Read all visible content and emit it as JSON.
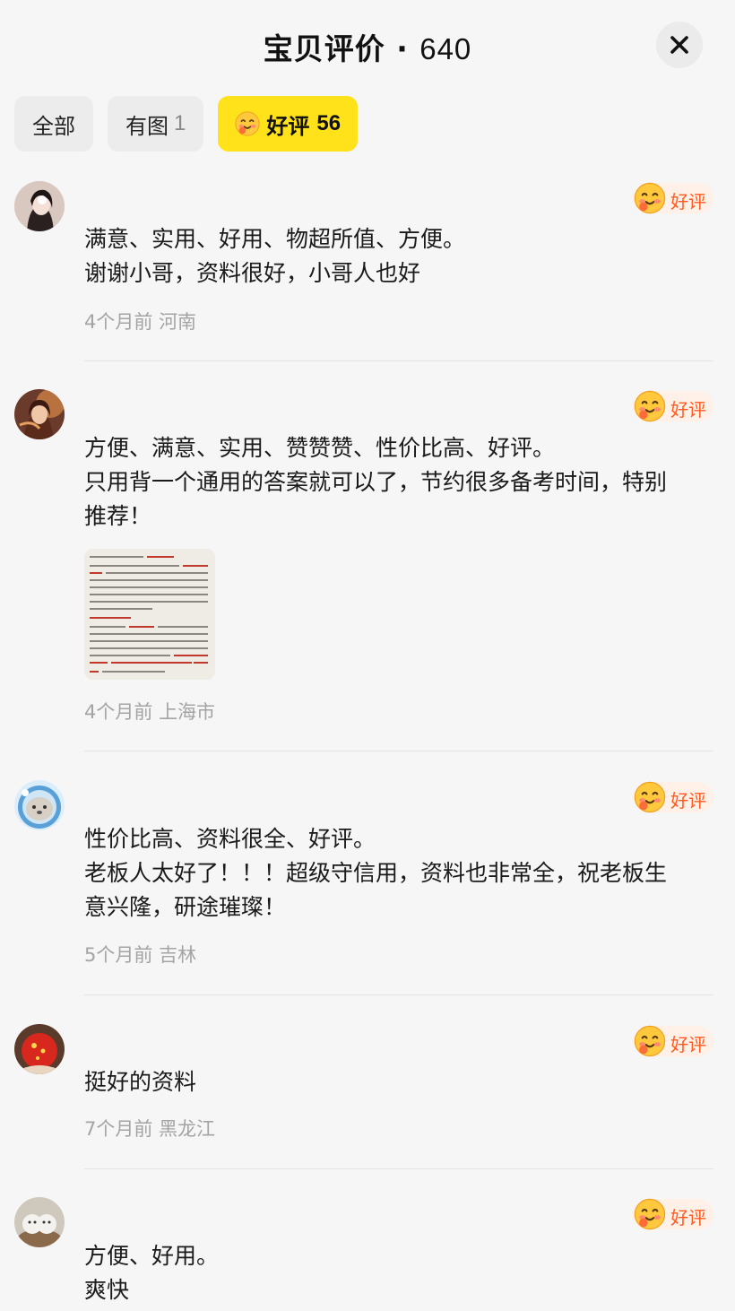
{
  "header": {
    "title": "宝贝评价",
    "separator": " · ",
    "count": "640"
  },
  "filters": [
    {
      "label": "全部",
      "num": ""
    },
    {
      "label": "有图",
      "num": "1"
    },
    {
      "label": "好评",
      "num": "56",
      "active": true
    }
  ],
  "badge_label": "好评",
  "reviews": [
    {
      "lines": [
        "满意、实用、好用、物超所值、方便。",
        "谢谢小哥，资料很好，小哥人也好"
      ],
      "time": "4个月前",
      "location": "河南"
    },
    {
      "lines": [
        "方便、满意、实用、赞赞赞、性价比高、好评。",
        "只用背一个通用的答案就可以了，节约很多备考时间，特别",
        "推荐！"
      ],
      "time": "4个月前",
      "location": "上海市",
      "has_image": true
    },
    {
      "lines": [
        "性价比高、资料很全、好评。",
        "老板人太好了！！！超级守信用，资料也非常全，祝老板生",
        "意兴隆，研途璀璨！"
      ],
      "time": "5个月前",
      "location": "吉林"
    },
    {
      "lines": [
        "挺好的资料"
      ],
      "time": "7个月前",
      "location": "黑龙江"
    },
    {
      "lines": [
        "方便、好用。",
        "爽快"
      ],
      "time": "",
      "location": ""
    }
  ],
  "colors": {
    "accent_yellow": "#ffe21a",
    "badge_text": "#ff5a1f",
    "badge_bg": "#fff0e8",
    "meta_gray": "#a4a4a4"
  }
}
